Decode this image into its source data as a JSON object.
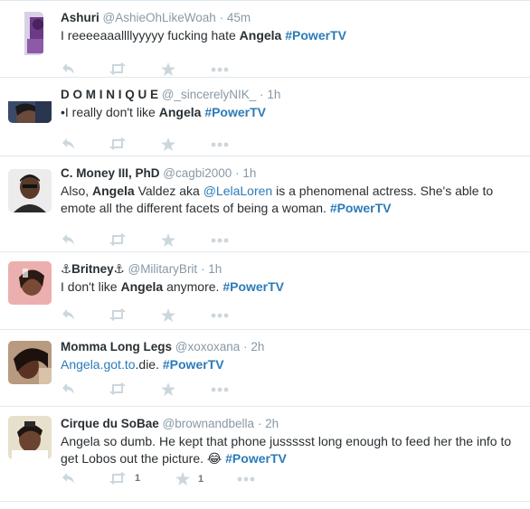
{
  "tweets": [
    {
      "fullname": "Ashuri",
      "username": "@AshieOhLikeWoah",
      "time": "45m",
      "text": [
        {
          "t": "I reeeeaaallllyyyyy fucking hate "
        },
        {
          "t": "Angela",
          "style": "bold"
        },
        {
          "t": " "
        },
        {
          "t": "#PowerTV",
          "style": "hashtag"
        }
      ],
      "retweet_count": "",
      "favorite_count": ""
    },
    {
      "fullname": "D O M I N I Q U E",
      "username": "@_sincerelyNIK_",
      "time": "1h",
      "text": [
        {
          "t": "•I really don't like "
        },
        {
          "t": "Angela",
          "style": "bold"
        },
        {
          "t": " "
        },
        {
          "t": "#PowerTV",
          "style": "hashtag"
        }
      ],
      "retweet_count": "",
      "favorite_count": ""
    },
    {
      "fullname": "C. Money III, PhD",
      "username": "@cagbi2000",
      "time": "1h",
      "text": [
        {
          "t": "Also, "
        },
        {
          "t": "Angela",
          "style": "bold"
        },
        {
          "t": " Valdez aka "
        },
        {
          "t": "@LelaLoren",
          "style": "mention"
        },
        {
          "t": " is a phenomenal actress. She's able to emote all the different facets of being a woman. "
        },
        {
          "t": "#PowerTV",
          "style": "hashtag"
        }
      ],
      "retweet_count": "",
      "favorite_count": ""
    },
    {
      "fullname": "⚓Britney⚓",
      "username": "@MilitaryBrit",
      "time": "1h",
      "text": [
        {
          "t": "I don't like "
        },
        {
          "t": "Angela",
          "style": "bold"
        },
        {
          "t": " anymore. "
        },
        {
          "t": "#PowerTV",
          "style": "hashtag"
        }
      ],
      "retweet_count": "",
      "favorite_count": ""
    },
    {
      "fullname": "Momma Long Legs",
      "username": "@xoxoxana",
      "time": "2h",
      "text": [
        {
          "t": "Angela.got.to",
          "style": "mention"
        },
        {
          "t": ".die. "
        },
        {
          "t": "#PowerTV",
          "style": "hashtag"
        }
      ],
      "retweet_count": "",
      "favorite_count": ""
    },
    {
      "fullname": "Cirque du SoBae",
      "username": "@brownandbella",
      "time": "2h",
      "text": [
        {
          "t": "Angela so dumb. He kept that phone jussssst long enough to feed her the info to get Lobos out the picture. 😂 "
        },
        {
          "t": "#PowerTV",
          "style": "hashtag"
        }
      ],
      "retweet_count": "1",
      "favorite_count": "1"
    }
  ],
  "colors": {
    "hashtag": "#2b7bb9",
    "meta": "#8899a6",
    "icon": "#ccd6dd",
    "divider": "#e1e8ed"
  },
  "icons": [
    "reply-icon",
    "retweet-icon",
    "favorite-icon",
    "more-icon"
  ]
}
